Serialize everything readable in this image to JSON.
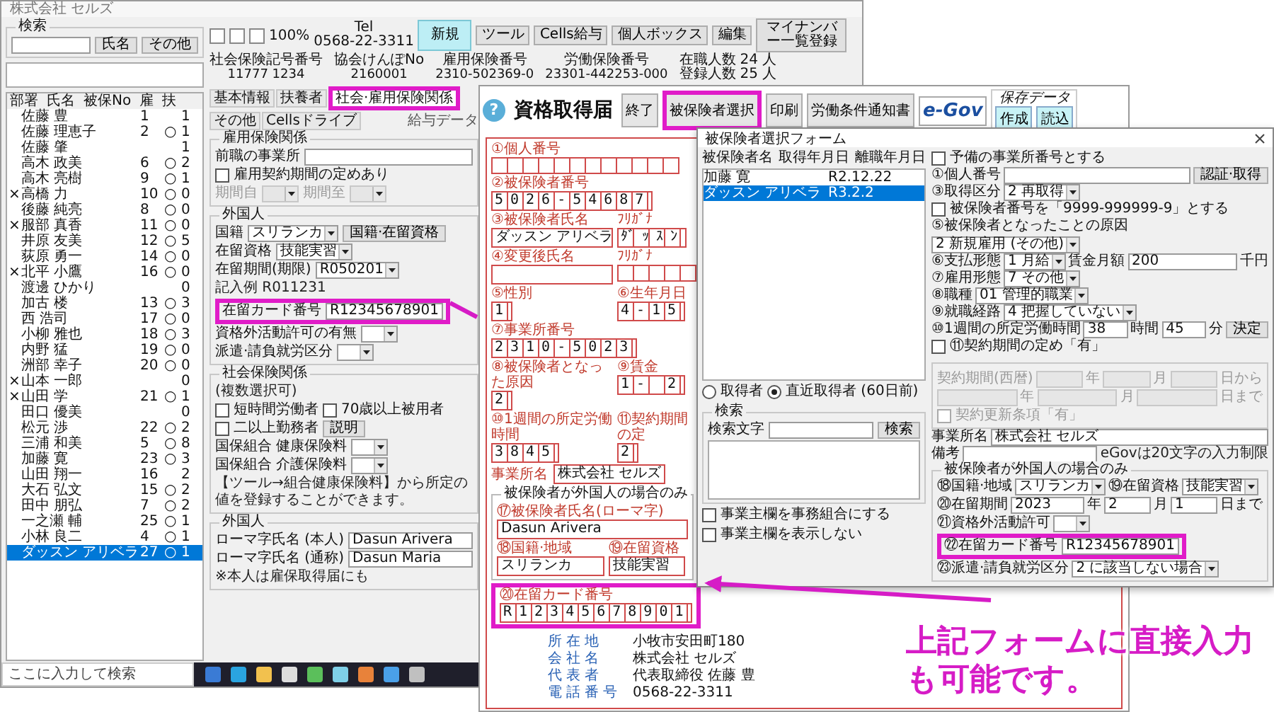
{
  "left_window": {
    "title": "株式会社 セルズ",
    "search": {
      "title": "検索",
      "buttons": [
        "氏名",
        "その他"
      ]
    },
    "employee_list": {
      "columns": [
        "部署",
        "氏名",
        "被保No",
        "雇",
        "扶"
      ],
      "rows": [
        {
          "name": "佐藤 豊",
          "no": "1",
          "fuyo": "1",
          "selected": false
        },
        {
          "name": "佐藤 理恵子",
          "no": "2",
          "koyo": "○",
          "fuyo": "1",
          "selected": false
        },
        {
          "name": "佐藤 肇",
          "fuyo": "1",
          "selected": false
        },
        {
          "name": "高木 政美",
          "no": "6",
          "koyo": "○",
          "fuyo": "2",
          "selected": false
        },
        {
          "name": "高木 亮樹",
          "no": "9",
          "koyo": "○",
          "fuyo": "1",
          "selected": false
        },
        {
          "dept": "×",
          "name": "高橋 力",
          "no": "10",
          "koyo": "○",
          "fuyo": "0",
          "selected": false
        },
        {
          "name": "後藤 純亮",
          "no": "8",
          "koyo": "○",
          "fuyo": "0",
          "selected": false
        },
        {
          "dept": "×",
          "name": "服部 真香",
          "no": "11",
          "koyo": "○",
          "fuyo": "0",
          "selected": false
        },
        {
          "name": "井原 友美",
          "no": "12",
          "koyo": "○",
          "fuyo": "5",
          "selected": false
        },
        {
          "name": "荻原 勇一",
          "no": "14",
          "koyo": "○",
          "fuyo": "0",
          "selected": false
        },
        {
          "dept": "×",
          "name": "北平 小鷹",
          "no": "16",
          "koyo": "○",
          "fuyo": "0",
          "selected": false
        },
        {
          "name": "渡邊 ひかり",
          "fuyo": "0",
          "selected": false
        },
        {
          "name": "加古 楼",
          "no": "13",
          "koyo": "○",
          "fuyo": "3",
          "selected": false
        },
        {
          "name": "西 浩司",
          "no": "17",
          "koyo": "○",
          "fuyo": "0",
          "selected": false
        },
        {
          "name": "小柳 雅也",
          "no": "18",
          "koyo": "○",
          "fuyo": "3",
          "selected": false
        },
        {
          "name": "内野 猛",
          "no": "19",
          "koyo": "○",
          "fuyo": "0",
          "selected": false
        },
        {
          "name": "洲部 幸子",
          "no": "20",
          "koyo": "○",
          "fuyo": "0",
          "selected": false
        },
        {
          "dept": "×",
          "name": "山本 一郎",
          "fuyo": "0",
          "selected": false
        },
        {
          "dept": "×",
          "name": "山田 学",
          "no": "21",
          "koyo": "○",
          "fuyo": "1",
          "selected": false
        },
        {
          "name": "田口 優美",
          "fuyo": "0",
          "selected": false
        },
        {
          "name": "松元 渉",
          "no": "22",
          "koyo": "○",
          "fuyo": "2",
          "selected": false
        },
        {
          "name": "三浦 和美",
          "no": "5",
          "koyo": "○",
          "fuyo": "8",
          "selected": false
        },
        {
          "name": "加藤 寛",
          "no": "23",
          "koyo": "○",
          "fuyo": "3",
          "selected": false
        },
        {
          "name": "山田 翔一",
          "no": "16",
          "fuyo": "2",
          "selected": false
        },
        {
          "name": "大石 弘文",
          "no": "15",
          "koyo": "○",
          "fuyo": "2",
          "selected": false
        },
        {
          "name": "田中 朋弘",
          "no": "7",
          "koyo": "○",
          "fuyo": "2",
          "selected": false
        },
        {
          "name": "一之瀬 輔",
          "no": "25",
          "koyo": "○",
          "fuyo": "1",
          "selected": false
        },
        {
          "name": "小林 良二",
          "no": "4",
          "koyo": "○",
          "fuyo": "1",
          "selected": false
        },
        {
          "name": "ダッスン アリベラ",
          "no": "27",
          "koyo": "○",
          "fuyo": "1",
          "selected": true
        }
      ]
    },
    "zoom": "100%",
    "tel_label": "Tel",
    "tel": "0568-22-3311",
    "toolbar_buttons": [
      {
        "label": "新規",
        "primary": true
      },
      {
        "label": "ツール",
        "primary": false
      },
      {
        "label": "Cells給与",
        "primary": false
      },
      {
        "label": "個人ボックス",
        "primary": false
      },
      {
        "label": "編集",
        "primary": false
      },
      {
        "label": "マイナンバー一覧登録",
        "primary": false
      }
    ],
    "info": [
      {
        "label": "社会保険記号番号",
        "value": "11777 1234"
      },
      {
        "label": "協会けんぽNo",
        "value": "2160001"
      },
      {
        "label": "雇用保険番号",
        "value": "2310-502369-0"
      },
      {
        "label": "労働保険番号",
        "value": "23301-442253-000"
      }
    ],
    "counts": [
      {
        "label": "在職人数",
        "value": "24",
        "unit": "人"
      },
      {
        "label": "登録人数",
        "value": "25",
        "unit": "人"
      }
    ],
    "tabs": [
      {
        "label": "基本情報",
        "selected": false,
        "highlighted": false
      },
      {
        "label": "扶養者",
        "selected": false,
        "highlighted": false
      },
      {
        "label": "社会·雇用保険関係",
        "selected": true,
        "highlighted": true
      },
      {
        "label": "その他",
        "selected": false,
        "highlighted": false
      },
      {
        "label": "Cellsドライブ",
        "selected": false,
        "highlighted": false
      }
    ],
    "salary_label": "給与データ",
    "sections": [
      {
        "title": "雇用保険関係",
        "rows": [
          {
            "items": [
              {
                "kind": "label",
                "text": "前職の事業所"
              },
              {
                "kind": "input"
              }
            ]
          },
          {
            "items": [
              {
                "kind": "check",
                "label": "雇用契約期間の定めあり",
                "checked": false
              }
            ]
          },
          {
            "items": [
              {
                "kind": "label",
                "text": "期間自",
                "disabled": true
              },
              {
                "kind": "combo",
                "disabled": true
              },
              {
                "kind": "label",
                "text": "期間至",
                "disabled": true
              },
              {
                "kind": "combo",
                "disabled": true
              }
            ]
          }
        ]
      },
      {
        "title": "外国人",
        "rows": [
          {
            "items": [
              {
                "kind": "label",
                "text": "国籍"
              },
              {
                "kind": "combo",
                "value": "スリランカ"
              },
              {
                "kind": "button",
                "label": "国籍·在留資格"
              }
            ]
          },
          {
            "items": [
              {
                "kind": "label",
                "text": "在留資格"
              },
              {
                "kind": "combo",
                "value": "技能実習"
              }
            ]
          },
          {
            "items": [
              {
                "kind": "label",
                "text": "在留期間(期限)"
              },
              {
                "kind": "combo",
                "value": "R050201"
              }
            ]
          },
          {
            "items": [
              {
                "kind": "note",
                "text": "記入例 R011231"
              }
            ]
          },
          {
            "items": [
              {
                "kind": "highlight",
                "items": [
                  {
                    "kind": "label",
                    "text": "在留カード番号"
                  },
                  {
                    "kind": "input",
                    "value": "R12345678901"
                  }
                ]
              }
            ]
          },
          {
            "items": [
              {
                "kind": "label",
                "text": "資格外活動許可の有無"
              },
              {
                "kind": "combo"
              }
            ]
          },
          {
            "items": [
              {
                "kind": "label",
                "text": "派遣·請負就労区分"
              },
              {
                "kind": "combo"
              }
            ]
          }
        ]
      },
      {
        "title": "社会保険関係",
        "rows": [
          {
            "items": [
              {
                "kind": "note",
                "text": "(複数選択可)"
              }
            ]
          },
          {
            "items": [
              {
                "kind": "check",
                "label": "短時間労働者",
                "checked": false
              },
              {
                "kind": "check",
                "label": "70歳以上被用者",
                "checked": false
              }
            ]
          },
          {
            "items": [
              {
                "kind": "check",
                "label": "二以上勤務者",
                "checked": false
              },
              {
                "kind": "button",
                "label": "説明"
              }
            ]
          },
          {
            "items": [
              {
                "kind": "label",
                "text": "国保組合 健康保険料"
              },
              {
                "kind": "combo"
              }
            ]
          },
          {
            "items": [
              {
                "kind": "label",
                "text": "国保組合 介護保険料"
              },
              {
                "kind": "combo"
              }
            ]
          },
          {
            "items": [
              {
                "kind": "note",
                "text": "【ツール→組合健康保険料】から所定の値を登録することができます。"
              }
            ]
          }
        ]
      },
      {
        "title": "外国人",
        "rows": [
          {
            "items": [
              {
                "kind": "label",
                "text": "ローマ字氏名 (本人)"
              },
              {
                "kind": "input",
                "value": "Dasun Arivera"
              }
            ]
          },
          {
            "items": [
              {
                "kind": "label",
                "text": "ローマ字氏名 (通称)"
              },
              {
                "kind": "input",
                "value": "Dasun Maria"
              }
            ]
          },
          {
            "items": [
              {
                "kind": "note",
                "text": "※本人は雇保取得届にも"
              }
            ]
          }
        ]
      }
    ],
    "taskbar_search": "ここに入力して検索"
  },
  "form_window": {
    "help": "?",
    "title": "資格取得届",
    "buttons": [
      {
        "label": "終了",
        "highlighted": false
      },
      {
        "label": "被保険者選択",
        "highlighted": true
      },
      {
        "label": "印刷",
        "highlighted": false
      },
      {
        "label": "労働条件通知書",
        "highlighted": false
      }
    ],
    "egov": "e-Gov",
    "save": {
      "title": "保存データ",
      "buttons": [
        "作成",
        "読込"
      ]
    },
    "fields": [
      [
        {
          "label": "①個人番号",
          "kind": "blank_boxes"
        }
      ],
      [
        {
          "label": "②被保険者番号",
          "kind": "boxes",
          "value": "5026-54687"
        }
      ],
      [
        {
          "label": "③被保険者氏名",
          "kind": "text",
          "value": "ダッスン アリベラ"
        },
        {
          "label": "ﾌﾘｶﾞﾅ",
          "kind": "boxes",
          "value": "ﾀﾞｯｽﾝ"
        }
      ],
      [
        {
          "label": "④変更後氏名",
          "kind": "blank_text"
        },
        {
          "label": "ﾌﾘｶﾞﾅ",
          "kind": "blank_boxes"
        }
      ],
      [
        {
          "label": "⑤性別",
          "kind": "boxes",
          "value": "1"
        },
        {
          "label": "⑥生年月日",
          "kind": "boxes",
          "value": "4-15"
        }
      ],
      [
        {
          "label": "⑦事業所番号",
          "kind": "boxes",
          "value": "2310-5023"
        }
      ],
      [
        {
          "label": "⑧被保険者となった原因",
          "kind": "boxes",
          "value": "2"
        },
        {
          "label": "⑨賃金",
          "kind": "boxes",
          "value": "1- 2"
        }
      ],
      [
        {
          "label": "⑩1週間の所定労働時間",
          "kind": "boxes",
          "value": "3845"
        },
        {
          "label": "⑪契約期間の定",
          "kind": "boxes",
          "value": "2"
        }
      ],
      [
        {
          "label": "事業所名",
          "kind": "inline_text",
          "value": "株式会社 セルズ"
        }
      ]
    ],
    "foreign": {
      "title": "被保険者が外国人の場合のみ",
      "fields": [
        [
          {
            "label": "⑰被保険者氏名(ローマ字)",
            "kind": "text",
            "value": "Dasun Arivera"
          }
        ],
        [
          {
            "label": "⑱国籍·地域",
            "kind": "text",
            "value": "スリランカ"
          },
          {
            "label": "⑲在留資格",
            "kind": "text",
            "value": "技能実習"
          }
        ]
      ]
    },
    "card_number": {
      "label": "⑳在留カード番号",
      "value": "R12345678901",
      "highlighted": true
    },
    "footer": [
      {
        "label": "所在地",
        "value": "小牧市安田町180"
      },
      {
        "label": "会社名",
        "value": "株式会社 セルズ"
      },
      {
        "label": "代表者",
        "value": "代表取締役 佐藤 豊"
      },
      {
        "label": "電話番号",
        "value": "0568-22-3311"
      }
    ]
  },
  "dialog": {
    "title": "被保険者選択フォーム",
    "list": {
      "columns": [
        "被保険者名",
        "取得年月日",
        "離職年月日"
      ],
      "rows": [
        {
          "cells": [
            "加藤 寛",
            "R2.12.22"
          ],
          "selected": false
        },
        {
          "cells": [
            "ダッスン アリベラ",
            "R3.2.2"
          ],
          "selected": true
        }
      ]
    },
    "filter": [
      {
        "kind": "radio",
        "label": "取得者",
        "selected": false
      },
      {
        "kind": "radio",
        "label": "直近取得者 (60日前)",
        "selected": true
      }
    ],
    "search": {
      "title": "検索",
      "row": [
        {
          "kind": "label",
          "text": "検索文字"
        },
        {
          "kind": "input"
        },
        {
          "kind": "button",
          "label": "検索"
        }
      ]
    },
    "options": [
      {
        "kind": "check",
        "label": "事業主欄を事務組合にする",
        "checked": false
      },
      {
        "kind": "check",
        "label": "事業主欄を表示しない",
        "checked": false
      }
    ],
    "blocks": [
      {
        "kind": "rows",
        "rows": [
          {
            "items": [
              {
                "kind": "check",
                "label": "予備の事業所番号とする",
                "checked": false
              }
            ]
          },
          {
            "items": [
              {
                "kind": "label",
                "text": "①個人番号"
              },
              {
                "kind": "input"
              },
              {
                "kind": "button",
                "label": "認証·取得"
              }
            ]
          },
          {
            "items": [
              {
                "kind": "label",
                "text": "③取得区分"
              },
              {
                "kind": "combo",
                "value": "2 再取得"
              }
            ]
          },
          {
            "items": [
              {
                "kind": "check",
                "label": "被保険者番号を「9999-999999-9」とする",
                "checked": false
              }
            ]
          },
          {
            "items": [
              {
                "kind": "label",
                "text": "⑤被保険者となったことの原因"
              },
              {
                "kind": "combo",
                "value": "2 新規雇用 (その他)"
              }
            ]
          },
          {
            "items": [
              {
                "kind": "label",
                "text": "⑥支払形態"
              },
              {
                "kind": "combo",
                "value": "1 月給"
              },
              {
                "kind": "label",
                "text": "賃金月額"
              },
              {
                "kind": "input",
                "value": "200"
              },
              {
                "kind": "label",
                "text": "千円"
              }
            ]
          },
          {
            "items": [
              {
                "kind": "label",
                "text": "⑦雇用形態"
              },
              {
                "kind": "combo",
                "value": "7 その他"
              }
            ]
          },
          {
            "items": [
              {
                "kind": "label",
                "text": "⑧職種"
              },
              {
                "kind": "combo",
                "value": "01 管理的職業"
              }
            ]
          },
          {
            "items": [
              {
                "kind": "label",
                "text": "⑨就職経路"
              },
              {
                "kind": "combo",
                "value": "4 把握していない"
              }
            ]
          },
          {
            "items": [
              {
                "kind": "label",
                "text": "⑩1週間の所定労働時間"
              },
              {
                "kind": "input",
                "value": "38"
              },
              {
                "kind": "label",
                "text": "時間"
              },
              {
                "kind": "input",
                "value": "45"
              },
              {
                "kind": "label",
                "text": "分"
              },
              {
                "kind": "button",
                "label": "決定"
              }
            ]
          },
          {
            "items": [
              {
                "kind": "check",
                "label": "⑪契約期間の定め「有」",
                "checked": false
              }
            ]
          }
        ]
      },
      {
        "kind": "group",
        "rows": [
          {
            "items": [
              {
                "kind": "label",
                "text": "契約期間(西暦)",
                "disabled": true
              },
              {
                "kind": "input",
                "disabled": true
              },
              {
                "kind": "label",
                "text": "年",
                "disabled": true
              },
              {
                "kind": "input",
                "disabled": true
              },
              {
                "kind": "label",
                "text": "月",
                "disabled": true
              },
              {
                "kind": "input",
                "disabled": true
              },
              {
                "kind": "label",
                "text": "日から",
                "disabled": true
              }
            ]
          },
          {
            "items": [
              {
                "kind": "input",
                "disabled": true
              },
              {
                "kind": "label",
                "text": "年",
                "disabled": true
              },
              {
                "kind": "input",
                "disabled": true
              },
              {
                "kind": "label",
                "text": "月",
                "disabled": true
              },
              {
                "kind": "input",
                "disabled": true
              },
              {
                "kind": "label",
                "text": "日まで",
                "disabled": true
              }
            ]
          },
          {
            "items": [
              {
                "kind": "check",
                "label": "契約更新条項「有」",
                "checked": false,
                "disabled": true
              }
            ]
          }
        ]
      },
      {
        "kind": "rows",
        "rows": [
          {
            "items": [
              {
                "kind": "label",
                "text": "事業所名"
              },
              {
                "kind": "input",
                "value": "株式会社 セルズ"
              }
            ]
          },
          {
            "items": [
              {
                "kind": "label",
                "text": "備考"
              },
              {
                "kind": "input"
              },
              {
                "kind": "note",
                "text": "eGovは20文字の入力制限"
              }
            ]
          }
        ]
      },
      {
        "kind": "group",
        "title": "被保険者が外国人の場合のみ",
        "rows": [
          {
            "items": [
              {
                "kind": "label",
                "text": "⑱国籍·地域"
              },
              {
                "kind": "combo",
                "value": "スリランカ"
              },
              {
                "kind": "label",
                "text": "⑲在留資格"
              },
              {
                "kind": "combo",
                "value": "技能実習"
              }
            ]
          },
          {
            "items": [
              {
                "kind": "label",
                "text": "⑳在留期間"
              },
              {
                "kind": "input",
                "value": "2023"
              },
              {
                "kind": "label",
                "text": "年"
              },
              {
                "kind": "input",
                "value": "2"
              },
              {
                "kind": "label",
                "text": "月"
              },
              {
                "kind": "input",
                "value": "1"
              },
              {
                "kind": "label",
                "text": "日まで"
              }
            ]
          },
          {
            "items": [
              {
                "kind": "label",
                "text": "㉑資格外活動許可"
              },
              {
                "kind": "combo"
              },
              {
                "kind": "highlight",
                "items": [
                  {
                    "kind": "label",
                    "text": "㉒在留カード番号"
                  },
                  {
                    "kind": "input",
                    "value": "R12345678901"
                  }
                ]
              }
            ]
          },
          {
            "items": [
              {
                "kind": "label",
                "text": "㉓派遣·請負就労区分"
              },
              {
                "kind": "combo",
                "value": "2 に該当しない場合"
              }
            ]
          }
        ]
      }
    ]
  },
  "callout": {
    "lines": [
      "上記フォームに直接入力",
      "も可能です。"
    ]
  }
}
